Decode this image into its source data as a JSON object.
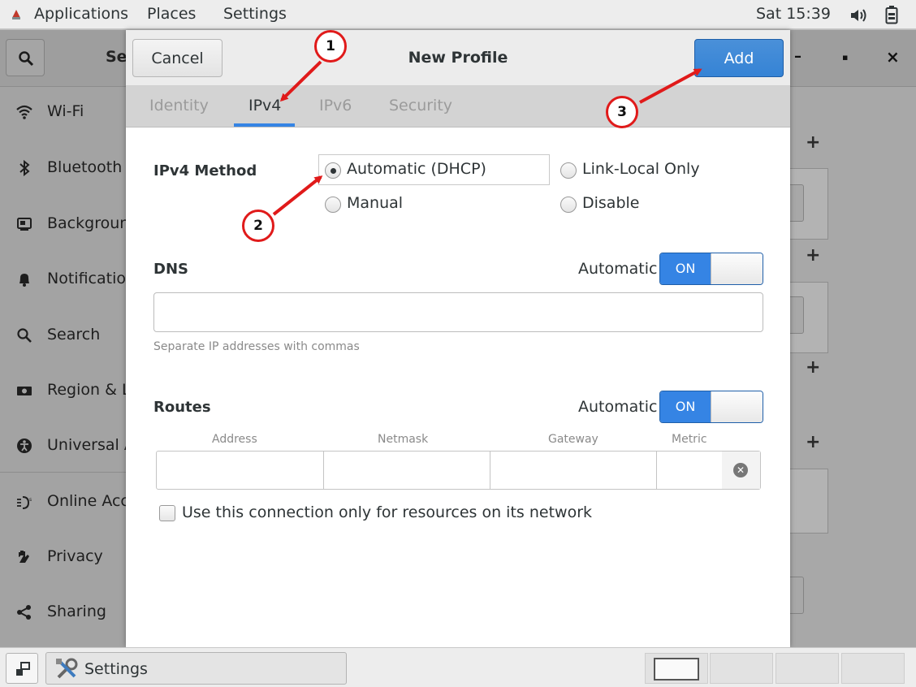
{
  "topbar": {
    "applications": "Applications",
    "places": "Places",
    "settings": "Settings",
    "clock": "Sat 15:39",
    "icons": [
      "app-menu-icon",
      "volume-icon",
      "battery-icon"
    ]
  },
  "background_window": {
    "title_partial": "Se",
    "controls": [
      "–",
      "▪",
      "×"
    ],
    "sidebar": [
      {
        "label": "Wi-Fi",
        "icon": "wifi-icon"
      },
      {
        "label": "Bluetooth",
        "icon": "bluetooth-icon"
      },
      {
        "label": "Background",
        "icon": "background-icon"
      },
      {
        "label": "Notifications",
        "icon": "bell-icon"
      },
      {
        "label": "Search",
        "icon": "search-icon"
      },
      {
        "label": "Region & Language",
        "icon": "region-icon"
      },
      {
        "label": "Universal Access",
        "icon": "accessibility-icon"
      },
      {
        "label": "Online Accounts",
        "icon": "online-accounts-icon"
      },
      {
        "label": "Privacy",
        "icon": "hand-icon"
      },
      {
        "label": "Sharing",
        "icon": "share-icon"
      }
    ],
    "plus": "+"
  },
  "dialog": {
    "title": "New Profile",
    "cancel": "Cancel",
    "add": "Add",
    "tabs": [
      "Identity",
      "IPv4",
      "IPv6",
      "Security"
    ],
    "active_tab": "IPv4",
    "ipv4_method_label": "IPv4 Method",
    "methods": [
      {
        "label": "Automatic (DHCP)",
        "checked": true
      },
      {
        "label": "Link-Local Only",
        "checked": false
      },
      {
        "label": "Manual",
        "checked": false
      },
      {
        "label": "Disable",
        "checked": false
      }
    ],
    "dns": {
      "label": "DNS",
      "automatic_label": "Automatic",
      "switch": "ON",
      "value": "",
      "hint": "Separate IP addresses with commas"
    },
    "routes": {
      "label": "Routes",
      "automatic_label": "Automatic",
      "switch": "ON",
      "columns": [
        "Address",
        "Netmask",
        "Gateway",
        "Metric"
      ]
    },
    "only_local_resources": {
      "label": "Use this connection only for resources on its network",
      "checked": false
    }
  },
  "annotations": [
    "1",
    "2",
    "3"
  ],
  "annotation_color": "#e01a1a",
  "accent_color": "#3584e4",
  "bottombar": {
    "task_label": "Settings"
  }
}
